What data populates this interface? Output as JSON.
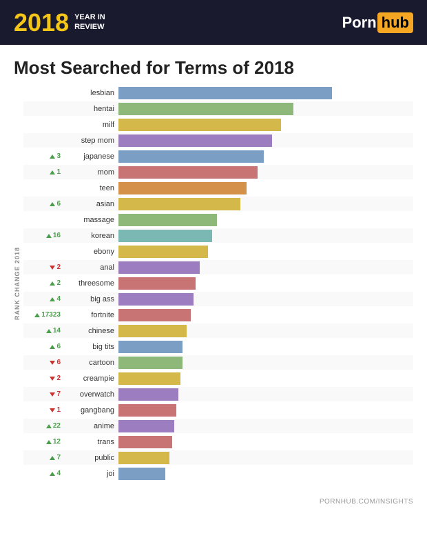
{
  "header": {
    "year": "2018",
    "year_sub": "YEAR IN\nREVIEW",
    "logo_porn": "Porn",
    "logo_hub": "hub"
  },
  "title": "Most Searched for Terms of 2018",
  "rank_label": "RANK CHANGE 2018",
  "footer_url": "PORNHUB.COM/INSIGHTS",
  "bars": [
    {
      "term": "lesbian",
      "change": "",
      "dir": "none",
      "pct": 100,
      "color": "#7b9ec4"
    },
    {
      "term": "hentai",
      "change": "",
      "dir": "none",
      "pct": 82,
      "color": "#8db87a"
    },
    {
      "term": "milf",
      "change": "",
      "dir": "none",
      "pct": 76,
      "color": "#d4b84a"
    },
    {
      "term": "step mom",
      "change": "",
      "dir": "none",
      "pct": 72,
      "color": "#9b7dc0"
    },
    {
      "term": "japanese",
      "change": "3",
      "dir": "up",
      "pct": 68,
      "color": "#7b9ec4"
    },
    {
      "term": "mom",
      "change": "1",
      "dir": "up",
      "pct": 65,
      "color": "#c97474"
    },
    {
      "term": "teen",
      "change": "",
      "dir": "none",
      "pct": 60,
      "color": "#d4914a"
    },
    {
      "term": "asian",
      "change": "6",
      "dir": "up",
      "pct": 57,
      "color": "#d4b84a"
    },
    {
      "term": "massage",
      "change": "",
      "dir": "none",
      "pct": 46,
      "color": "#8db87a"
    },
    {
      "term": "korean",
      "change": "16",
      "dir": "up",
      "pct": 44,
      "color": "#7bb8b4"
    },
    {
      "term": "ebony",
      "change": "",
      "dir": "none",
      "pct": 42,
      "color": "#d4b84a"
    },
    {
      "term": "anal",
      "change": "2",
      "dir": "down",
      "pct": 38,
      "color": "#9b7dc0"
    },
    {
      "term": "threesome",
      "change": "2",
      "dir": "up",
      "pct": 36,
      "color": "#c97474"
    },
    {
      "term": "big ass",
      "change": "4",
      "dir": "up",
      "pct": 35,
      "color": "#9b7dc0"
    },
    {
      "term": "fortnite",
      "change": "17323",
      "dir": "up",
      "pct": 34,
      "color": "#c97474"
    },
    {
      "term": "chinese",
      "change": "14",
      "dir": "up",
      "pct": 32,
      "color": "#d4b84a"
    },
    {
      "term": "big tits",
      "change": "6",
      "dir": "up",
      "pct": 30,
      "color": "#7b9ec4"
    },
    {
      "term": "cartoon",
      "change": "6",
      "dir": "down",
      "pct": 30,
      "color": "#8db87a"
    },
    {
      "term": "creampie",
      "change": "2",
      "dir": "down",
      "pct": 29,
      "color": "#d4b84a"
    },
    {
      "term": "overwatch",
      "change": "7",
      "dir": "down",
      "pct": 28,
      "color": "#9b7dc0"
    },
    {
      "term": "gangbang",
      "change": "1",
      "dir": "down",
      "pct": 27,
      "color": "#c97474"
    },
    {
      "term": "anime",
      "change": "22",
      "dir": "up",
      "pct": 26,
      "color": "#9b7dc0"
    },
    {
      "term": "trans",
      "change": "12",
      "dir": "up",
      "pct": 25,
      "color": "#c97474"
    },
    {
      "term": "public",
      "change": "7",
      "dir": "up",
      "pct": 24,
      "color": "#d4b84a"
    },
    {
      "term": "joi",
      "change": "4",
      "dir": "up",
      "pct": 22,
      "color": "#7b9ec4"
    }
  ]
}
